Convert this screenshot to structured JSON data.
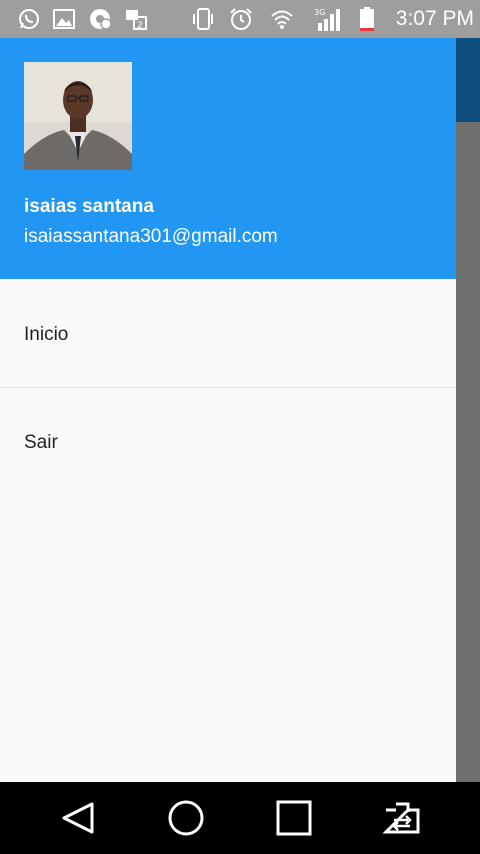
{
  "status_bar": {
    "time": "3:07 PM",
    "icons": [
      "whatsapp-icon",
      "gallery-icon",
      "chrome-notification-icon",
      "messages-icon",
      "vibrate-icon",
      "alarm-icon",
      "wifi-icon",
      "signal-3g-icon",
      "battery-icon"
    ],
    "network_label": "3G"
  },
  "drawer": {
    "account": {
      "name": "isaias santana",
      "email": "isaiassantana301@gmail.com"
    },
    "menu": [
      {
        "label": "Inicio"
      },
      {
        "label": "Sair"
      }
    ]
  },
  "colors": {
    "header": "#2196f3",
    "drawer_bg": "#fafafa",
    "scrim": "#6e6e6e",
    "app_bar_peek": "#0d4d7d"
  },
  "nav_bar": {
    "buttons": [
      "back-icon",
      "home-icon",
      "recents-icon",
      "switch-app-icon"
    ]
  }
}
